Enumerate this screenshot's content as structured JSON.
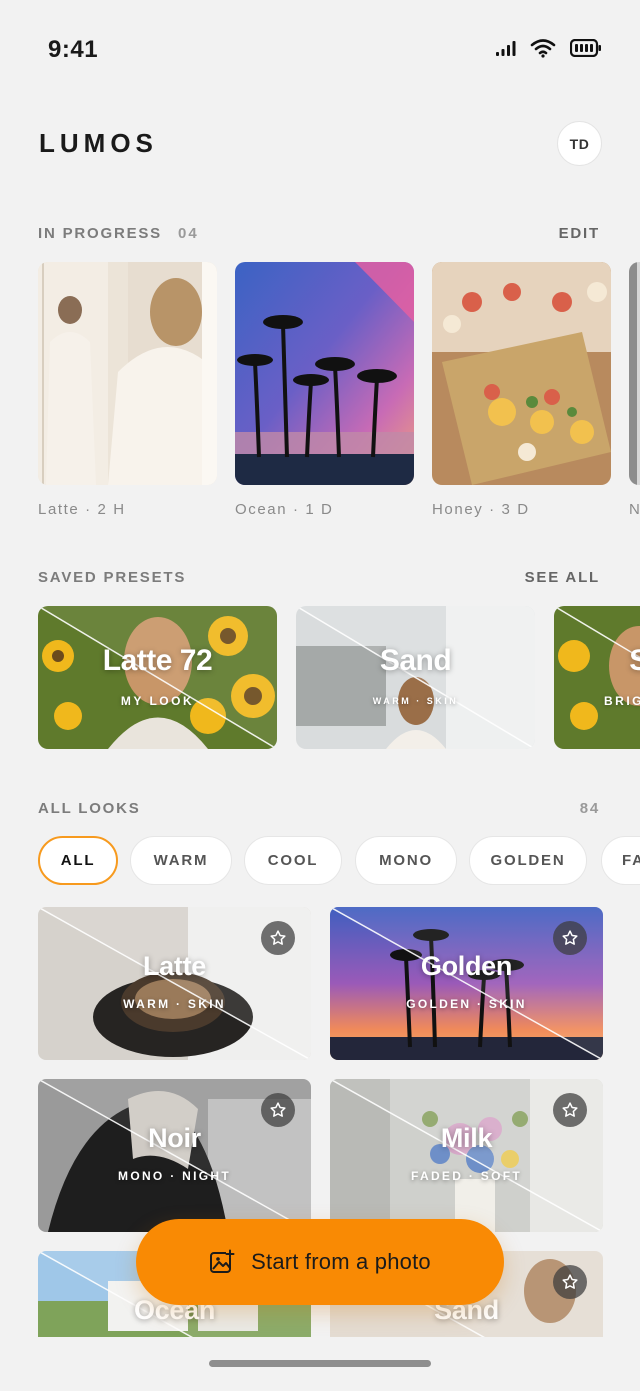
{
  "status_bar": {
    "time": "9:41"
  },
  "header": {
    "brand": "LUMOS",
    "avatar_initials": "TD"
  },
  "in_progress": {
    "label": "IN PROGRESS",
    "count": "04",
    "action": "EDIT",
    "items": [
      {
        "label": "Latte · 2 H"
      },
      {
        "label": "Ocean · 1 D"
      },
      {
        "label": "Honey · 3 D"
      },
      {
        "label": "N"
      }
    ]
  },
  "saved_presets": {
    "label": "SAVED PRESETS",
    "action": "SEE ALL",
    "items": [
      {
        "title": "Latte 72",
        "subtitle": "MY LOOK"
      },
      {
        "title": "Sand",
        "subtitle": "WARM · SKIN"
      },
      {
        "title": "S",
        "subtitle": "BRIG"
      }
    ]
  },
  "all_looks": {
    "label": "ALL LOOKS",
    "count": "84",
    "filters": [
      "ALL",
      "WARM",
      "COOL",
      "MONO",
      "GOLDEN",
      "FA"
    ],
    "active_filter": "ALL",
    "items": [
      {
        "title": "Latte",
        "subtitle": "WARM · SKIN"
      },
      {
        "title": "Golden",
        "subtitle": "GOLDEN · SKIN"
      },
      {
        "title": "Noir",
        "subtitle": "MONO · NIGHT"
      },
      {
        "title": "Milk",
        "subtitle": "FADED · SOFT"
      },
      {
        "title": "Ocean",
        "subtitle": ""
      },
      {
        "title": "Sand",
        "subtitle": ""
      }
    ]
  },
  "cta": {
    "label": "Start from a photo",
    "icon": "add-photo-icon"
  },
  "colors": {
    "accent": "#f98a04",
    "chip_active_border": "#f79a1e",
    "background": "#f2f2f2"
  }
}
